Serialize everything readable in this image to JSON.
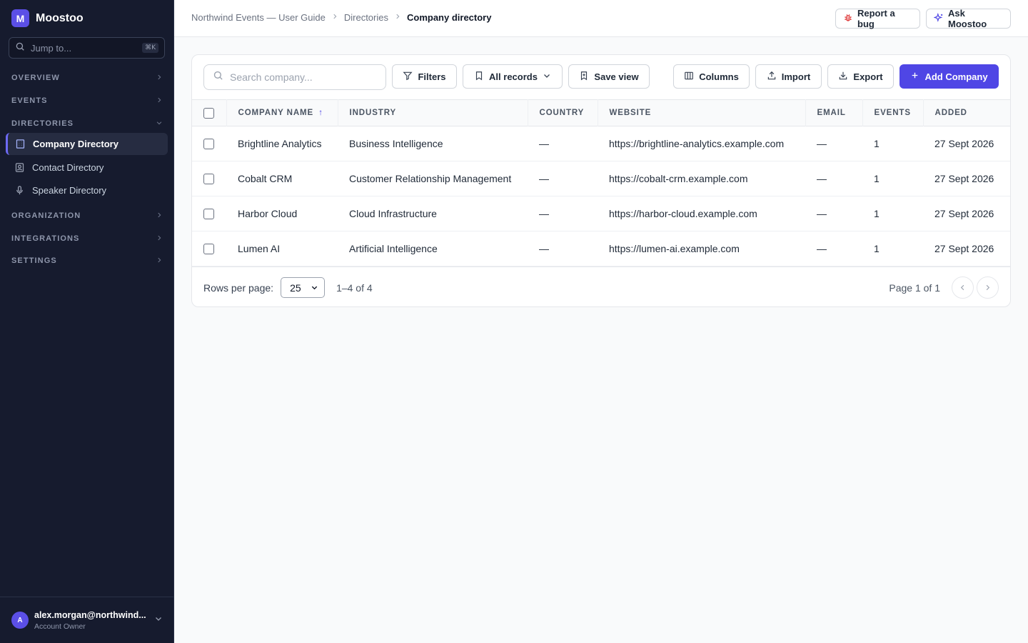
{
  "app": {
    "logo_letter": "M",
    "name": "Moostoo"
  },
  "jump": {
    "placeholder": "Jump to...",
    "shortcut": "⌘K"
  },
  "sidebar": {
    "sections": [
      {
        "label": "OVERVIEW"
      },
      {
        "label": "EVENTS"
      },
      {
        "label": "DIRECTORIES"
      },
      {
        "label": "ORGANIZATION"
      },
      {
        "label": "INTEGRATIONS"
      },
      {
        "label": "SETTINGS"
      }
    ],
    "directory_items": [
      {
        "label": "Company Directory",
        "icon": "building-icon",
        "active": true
      },
      {
        "label": "Contact Directory",
        "icon": "contact-card-icon",
        "active": false
      },
      {
        "label": "Speaker Directory",
        "icon": "microphone-icon",
        "active": false
      }
    ]
  },
  "user": {
    "avatar_letter": "A",
    "email": "alex.morgan@northwind...",
    "role": "Account Owner"
  },
  "breadcrumb": {
    "items": [
      "Northwind Events — User Guide",
      "Directories"
    ],
    "current": "Company directory"
  },
  "top_actions": {
    "report_bug": "Report a bug",
    "ask": "Ask Moostoo"
  },
  "toolbar": {
    "search_placeholder": "Search company...",
    "filters": "Filters",
    "records": "All records",
    "save_view": "Save view",
    "columns": "Columns",
    "import": "Import",
    "export": "Export",
    "add": "Add Company"
  },
  "table": {
    "columns": [
      "COMPANY NAME",
      "INDUSTRY",
      "COUNTRY",
      "WEBSITE",
      "EMAIL",
      "EVENTS",
      "ADDED"
    ],
    "sort_indicator": "↑",
    "rows": [
      [
        "Brightline Analytics",
        "Business Intelligence",
        "—",
        "https://brightline-analytics.example.com",
        "—",
        "1",
        "27 Sept 2026"
      ],
      [
        "Cobalt CRM",
        "Customer Relationship Management",
        "—",
        "https://cobalt-crm.example.com",
        "—",
        "1",
        "27 Sept 2026"
      ],
      [
        "Harbor Cloud",
        "Cloud Infrastructure",
        "—",
        "https://harbor-cloud.example.com",
        "—",
        "1",
        "27 Sept 2026"
      ],
      [
        "Lumen AI",
        "Artificial Intelligence",
        "—",
        "https://lumen-ai.example.com",
        "—",
        "1",
        "27 Sept 2026"
      ]
    ]
  },
  "pagination": {
    "rows_label": "Rows per page:",
    "rows_value": "25",
    "range": "1–4 of 4",
    "page": "Page 1 of 1"
  },
  "colors": {
    "accent": "#4f46e5",
    "sidebar_bg": "#161b2e",
    "bug_red": "#dc2626"
  }
}
